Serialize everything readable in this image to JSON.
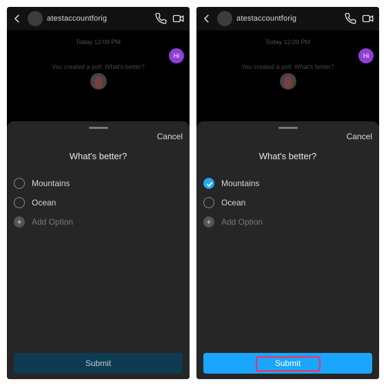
{
  "colors": {
    "accent": "#1aa6ff",
    "bubble": "#8f3fd6",
    "highlight": "#ff2b5d"
  },
  "header": {
    "username": "atestaccountforig",
    "timestamp": "Today 12:09 PM",
    "bubble_text": "Hi",
    "poll_notice": "You created a poll: What's better?"
  },
  "sheet": {
    "cancel": "Cancel",
    "question": "What's better?",
    "options": [
      "Mountains",
      "Ocean"
    ],
    "add_option": "Add Option",
    "submit": "Submit"
  },
  "left_screen": {
    "selected_index": -1,
    "submit_enabled": false
  },
  "right_screen": {
    "selected_index": 0,
    "submit_enabled": true,
    "submit_highlighted": true
  }
}
